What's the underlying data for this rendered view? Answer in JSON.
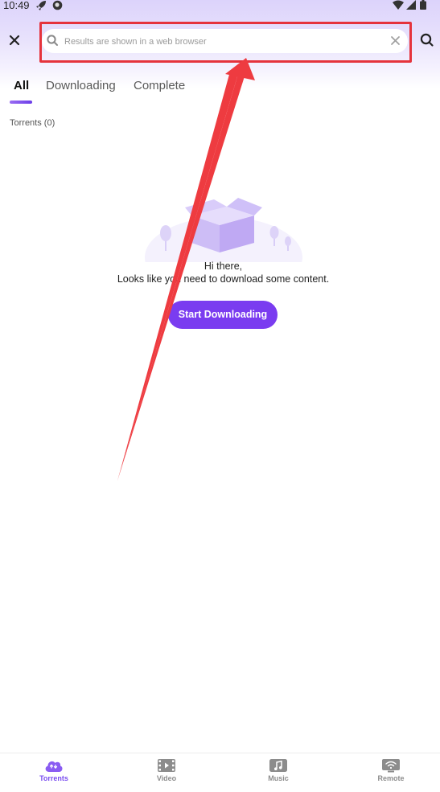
{
  "status_bar": {
    "time": "10:49"
  },
  "search": {
    "placeholder": "Results are shown in a web browser",
    "value": ""
  },
  "tabs": [
    {
      "label": "All",
      "active": true
    },
    {
      "label": "Downloading",
      "active": false
    },
    {
      "label": "Complete",
      "active": false
    }
  ],
  "section": {
    "label": "Torrents (0)"
  },
  "empty_state": {
    "title": "Hi there,",
    "subtitle": "Looks like you need to download some content.",
    "button_label": "Start Downloading"
  },
  "bottom_nav": [
    {
      "label": "Torrents",
      "icon": "cloud-download-icon",
      "active": true
    },
    {
      "label": "Video",
      "icon": "film-icon",
      "active": false
    },
    {
      "label": "Music",
      "icon": "music-note-icon",
      "active": false
    },
    {
      "label": "Remote",
      "icon": "remote-wifi-icon",
      "active": false
    }
  ],
  "colors": {
    "accent": "#7a3cf0",
    "annotation_red": "#e5333c",
    "header_gradient_top": "#dcd3fb"
  }
}
